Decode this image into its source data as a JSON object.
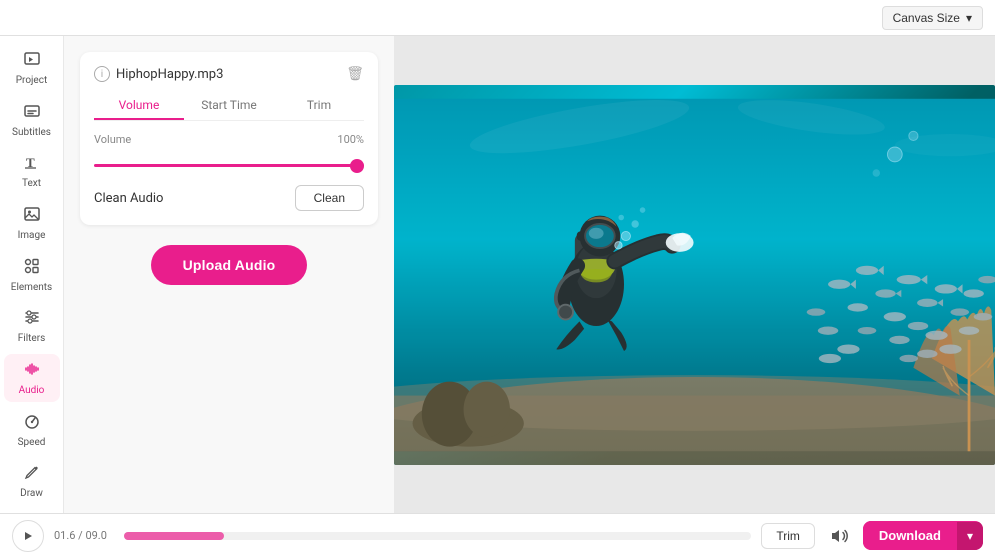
{
  "topbar": {
    "canvas_size_label": "Canvas Size",
    "chevron": "▾"
  },
  "sidebar": {
    "items": [
      {
        "id": "project",
        "icon": "🎬",
        "label": "Project"
      },
      {
        "id": "subtitles",
        "icon": "💬",
        "label": "Subtitles"
      },
      {
        "id": "text",
        "icon": "T",
        "label": "Text"
      },
      {
        "id": "image",
        "icon": "🖼",
        "label": "Image"
      },
      {
        "id": "elements",
        "icon": "✦",
        "label": "Elements"
      },
      {
        "id": "filters",
        "icon": "≡",
        "label": "Filters"
      },
      {
        "id": "audio",
        "icon": "♪",
        "label": "Audio"
      },
      {
        "id": "speed",
        "icon": "⏱",
        "label": "Speed"
      },
      {
        "id": "draw",
        "icon": "✏",
        "label": "Draw"
      }
    ]
  },
  "audio_panel": {
    "filename": "HiphopHappy.mp3",
    "info_symbol": "i",
    "trash_symbol": "🗑",
    "tabs": [
      "Volume",
      "Start Time",
      "Trim"
    ],
    "active_tab": "Volume",
    "volume_label": "Volume",
    "volume_value": "100%",
    "clean_audio_label": "Clean Audio",
    "clean_button": "Clean",
    "upload_button": "Upload Audio"
  },
  "bottombar": {
    "time_display": "01.6 / 09.0",
    "trim_label": "Trim",
    "download_label": "Download",
    "download_arrow": "▾"
  },
  "colors": {
    "accent": "#e91e8c",
    "accent_dark": "#c4166f"
  }
}
